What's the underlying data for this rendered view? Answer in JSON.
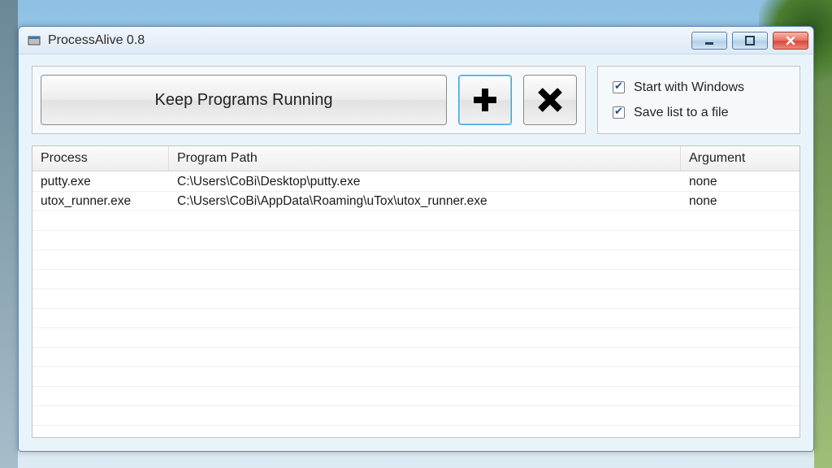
{
  "window": {
    "title": "ProcessAlive 0.8"
  },
  "toolbar": {
    "keep_running_label": "Keep Programs Running",
    "add_label": "+",
    "remove_label": "✕"
  },
  "options": {
    "start_with_windows": {
      "label": "Start with Windows",
      "checked": true
    },
    "save_list": {
      "label": "Save list to a file",
      "checked": true
    }
  },
  "table": {
    "columns": {
      "process": "Process",
      "path": "Program Path",
      "argument": "Argument"
    },
    "rows": [
      {
        "process": "putty.exe",
        "path": "C:\\Users\\CoBi\\Desktop\\putty.exe",
        "argument": "none"
      },
      {
        "process": "utox_runner.exe",
        "path": "C:\\Users\\CoBi\\AppData\\Roaming\\uTox\\utox_runner.exe",
        "argument": "none"
      }
    ]
  }
}
